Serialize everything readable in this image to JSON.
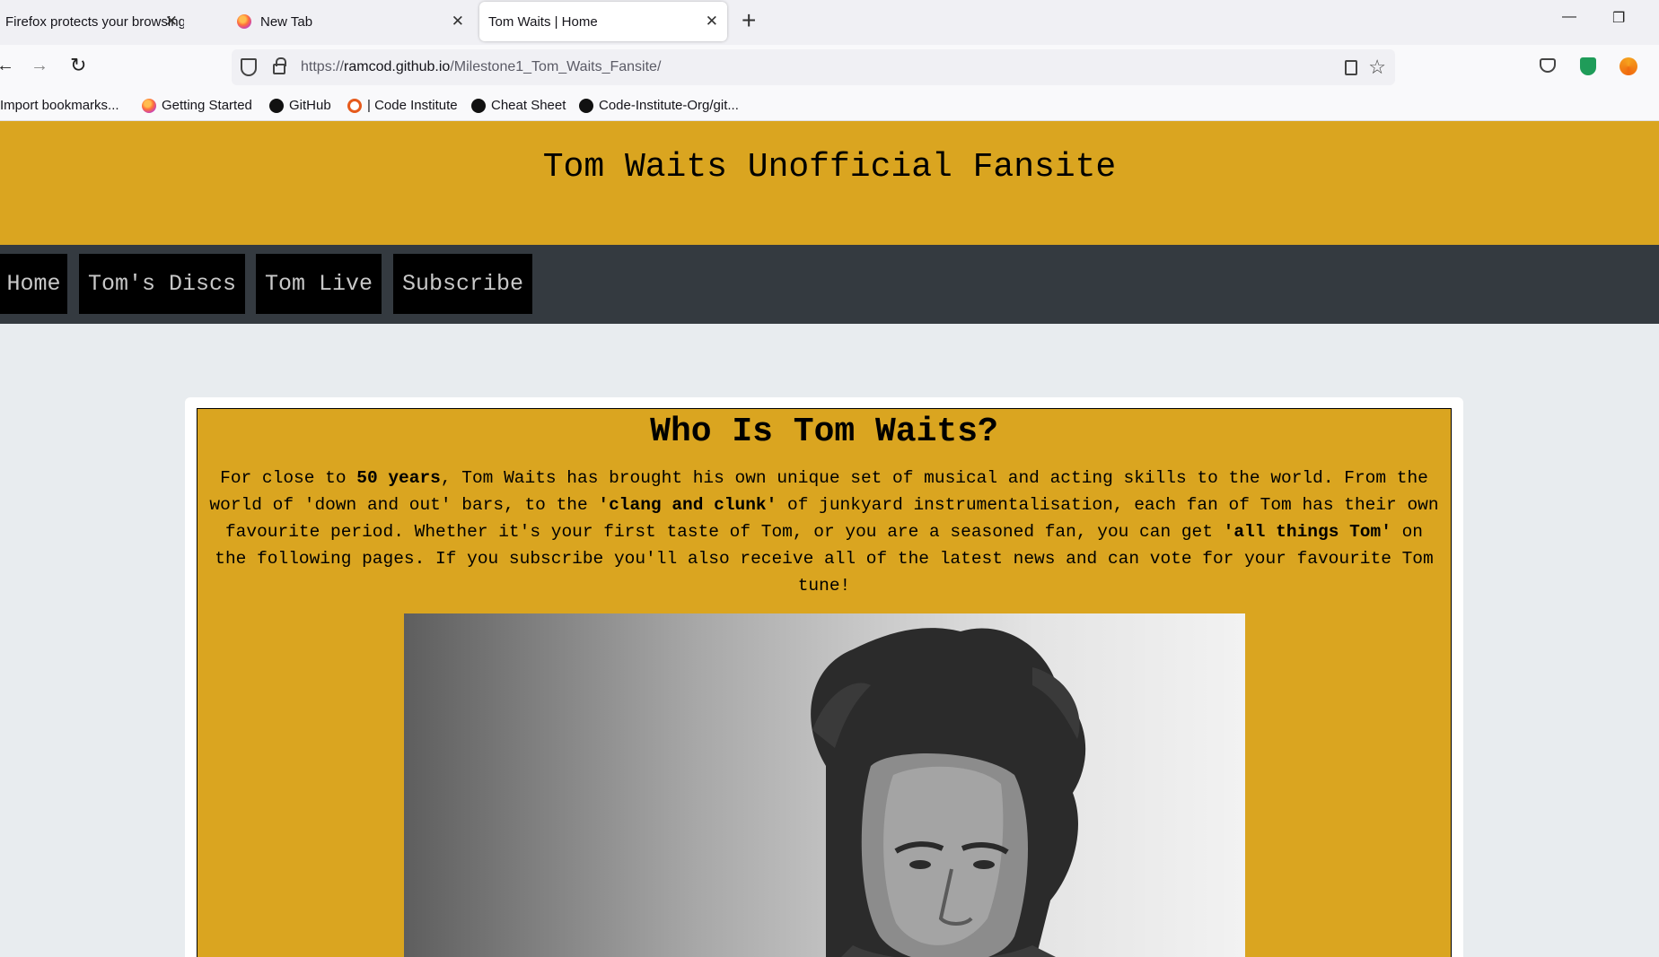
{
  "browser": {
    "tabs": [
      {
        "title": "Firefox protects your browsing.",
        "active": false
      },
      {
        "title": "New Tab",
        "active": false
      },
      {
        "title": "Tom Waits | Home",
        "active": true
      }
    ],
    "url": {
      "scheme": "https://",
      "domain": "ramcod.github.io",
      "path": "/Milestone1_Tom_Waits_Fansite/"
    },
    "bookmarks": [
      {
        "label": "Import bookmarks...",
        "icon": "import-icon"
      },
      {
        "label": "Getting Started",
        "icon": "firefox-icon"
      },
      {
        "label": "GitHub",
        "icon": "github-icon"
      },
      {
        "label": "| Code Institute",
        "icon": "code-institute-icon"
      },
      {
        "label": "Cheat Sheet",
        "icon": "cheat-sheet-icon"
      },
      {
        "label": "Code-Institute-Org/git...",
        "icon": "github-icon"
      }
    ]
  },
  "site": {
    "title": "Tom Waits Unofficial Fansite",
    "nav": [
      "Home",
      "Tom's Discs",
      "Tom Live",
      "Subscribe"
    ],
    "section": {
      "heading": "Who Is Tom Waits?",
      "intro": {
        "t1": "For close to ",
        "b1": "50 years",
        "t2": ", Tom Waits has brought his own unique set of musical and acting skills to the world. From the world of 'down and out' bars, to the ",
        "b2": "'clang and clunk'",
        "t3": " of junkyard instrumentalisation, each fan of Tom has their own favourite period. Whether it's your first taste of Tom, or you are a seasoned fan, you can get ",
        "b3": "'all things Tom'",
        "t4": " on the following pages. If you subscribe you'll also receive all of the latest news and can vote for your favourite Tom tune!"
      }
    }
  },
  "colors": {
    "header_gold": "#daa520",
    "nav_dark": "#343a40",
    "nav_button": "#000000",
    "page_bg": "#e8ecef"
  }
}
